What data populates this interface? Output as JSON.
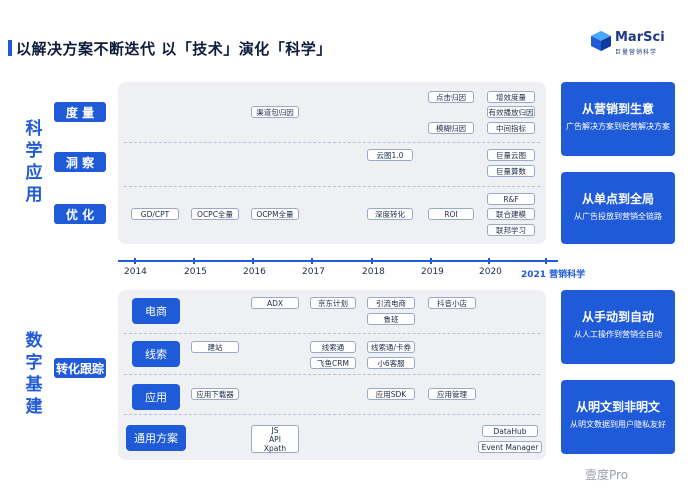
{
  "title": "以解决方案不断迭代 以「技术」演化「科学」",
  "logo": {
    "name": "MarSci",
    "sub": "巨量营销科学"
  },
  "upper": {
    "section_label": "科学应用",
    "categories": [
      "度 量",
      "洞 察",
      "优 化"
    ],
    "tags": {
      "qudao": "渠道包归因",
      "dianzhao": "点击归因",
      "moxing": "模糊归因",
      "zengxiao": "增效度量",
      "youxiao": "有效播放归因",
      "zhongjian": "中间指标",
      "yuntu": "云图1.0",
      "julyt": "巨量云图",
      "julsw": "巨量算数",
      "gdcpt": "GD/CPT",
      "ocpc": "OCPC全量",
      "ocpm": "OCPM全量",
      "shendu": "深度转化",
      "roi": "ROI",
      "rf": "R&F",
      "lianhejianmo": "联合建模",
      "lianbang": "联邦学习"
    },
    "right": [
      {
        "title": "从营销到生意",
        "sub": "广告解决方案到经营解决方案"
      },
      {
        "title": "从单点到全局",
        "sub": "从广告投放到营销全链路"
      }
    ]
  },
  "timeline": {
    "years": [
      "2014",
      "2015",
      "2016",
      "2017",
      "2018",
      "2019",
      "2020",
      "2021 营销科学"
    ]
  },
  "lower": {
    "section_label": "数字基建",
    "side_category": "转化跟踪",
    "categories": [
      "电商",
      "线索",
      "应用",
      "通用方案"
    ],
    "tags": {
      "adx": "ADX",
      "jingdong": "京东计划",
      "yindao": "引流电商",
      "lupan": "鲁班",
      "douyin": "抖音小店",
      "jianzhan": "建站",
      "xiansuotong": "线索通",
      "feiyu": "飞鱼CRM",
      "xiansuokaquan": "线索通/卡券",
      "xiaoliu": "小6客服",
      "yingyongxiazai": "应用下载器",
      "yingyongsdk": "应用SDK",
      "yingyongguanli": "应用管理",
      "jsapi": "JS\nAPI\nXpath",
      "datahub": "DataHub",
      "eventmanager": "Event Manager"
    },
    "right": [
      {
        "title": "从手动到自动",
        "sub": "从人工操作到营销全自动"
      },
      {
        "title": "从明文到非明文",
        "sub": "从明文数据到用户隐私友好"
      }
    ]
  },
  "watermark": "壹度Pro"
}
